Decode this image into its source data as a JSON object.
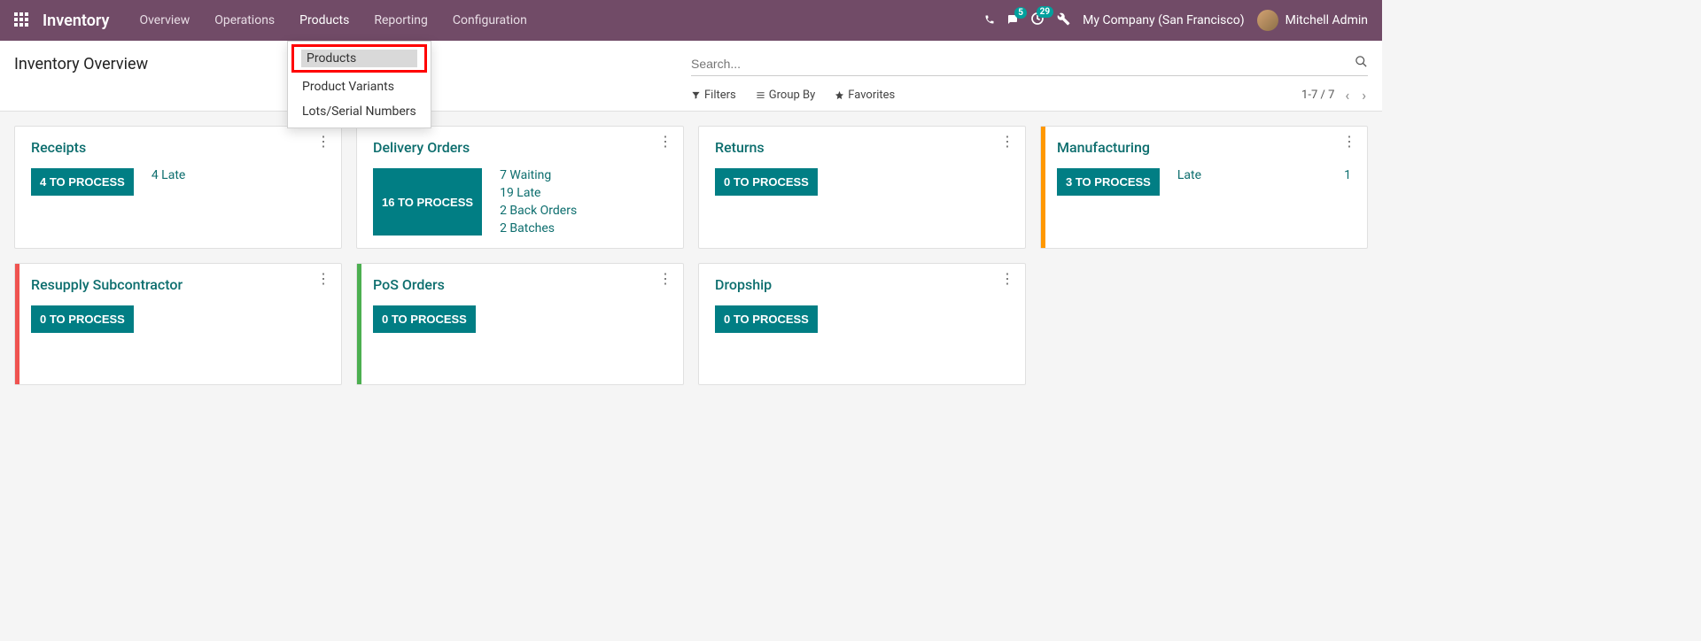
{
  "navbar": {
    "brand": "Inventory",
    "menu": [
      "Overview",
      "Operations",
      "Products",
      "Reporting",
      "Configuration"
    ],
    "active_menu_index": 2,
    "messages_badge": "5",
    "activities_badge": "29",
    "company": "My Company (San Francisco)",
    "user": "Mitchell Admin"
  },
  "subbar": {
    "title": "Inventory Overview",
    "search_placeholder": "Search...",
    "filters_label": "Filters",
    "groupby_label": "Group By",
    "favorites_label": "Favorites",
    "pager": "1-7 / 7"
  },
  "dropdown": {
    "items": [
      "Products",
      "Product Variants",
      "Lots/Serial Numbers"
    ],
    "highlighted_index": 0
  },
  "cards": [
    {
      "title": "Receipts",
      "process": "4 TO PROCESS",
      "stripe": "",
      "extras": [
        {
          "text": "4 Late"
        }
      ]
    },
    {
      "title": "Delivery Orders",
      "process": "16 TO PROCESS",
      "stripe": "",
      "extras": [
        {
          "text": "7 Waiting"
        },
        {
          "text": "19 Late"
        },
        {
          "text": "2 Back Orders"
        },
        {
          "text": "2 Batches"
        }
      ]
    },
    {
      "title": "Returns",
      "process": "0 TO PROCESS",
      "stripe": "",
      "extras": []
    },
    {
      "title": "Manufacturing",
      "process": "3 TO PROCESS",
      "stripe": "orange",
      "inline": {
        "label": "Late",
        "value": "1"
      }
    },
    {
      "title": "Resupply Subcontractor",
      "process": "0 TO PROCESS",
      "stripe": "red",
      "extras": []
    },
    {
      "title": "PoS Orders",
      "process": "0 TO PROCESS",
      "stripe": "green",
      "extras": []
    },
    {
      "title": "Dropship",
      "process": "0 TO PROCESS",
      "stripe": "",
      "extras": []
    }
  ]
}
